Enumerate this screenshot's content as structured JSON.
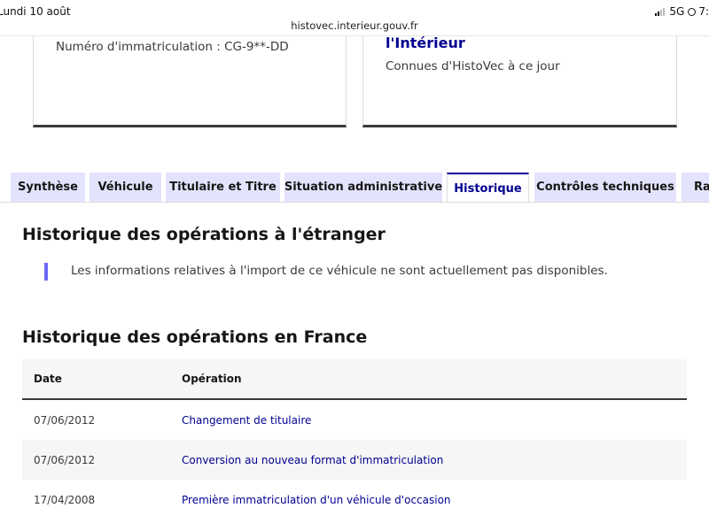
{
  "status_bar": {
    "date": "Lundi 10 août",
    "network": "5G",
    "time_partial": "7:",
    "url": "histovec.interieur.gouv.fr"
  },
  "cards": {
    "left": {
      "text": "Numéro d'immatriculation : CG-9**-DD"
    },
    "right": {
      "title": "l'Intérieur",
      "subtitle": "Connues d'HistoVec à ce jour"
    }
  },
  "tabs": [
    {
      "label": "Synthèse",
      "active": false
    },
    {
      "label": "Véhicule",
      "active": false
    },
    {
      "label": "Titulaire et Titre",
      "active": false
    },
    {
      "label": "Situation administrative",
      "active": false
    },
    {
      "label": "Historique",
      "active": true
    },
    {
      "label": "Contrôles techniques",
      "active": false
    },
    {
      "label": "Ra",
      "active": false
    }
  ],
  "foreign_section": {
    "title": "Historique des opérations à l'étranger",
    "notice": "Les informations relatives à l'import de ce véhicule ne sont actuellement pas disponibles."
  },
  "france_section": {
    "title": "Historique des opérations en France",
    "columns": [
      "Date",
      "Opération"
    ],
    "rows": [
      {
        "date": "07/06/2012",
        "operation": "Changement de titulaire"
      },
      {
        "date": "07/06/2012",
        "operation": "Conversion au nouveau format d'immatriculation"
      },
      {
        "date": "17/04/2008",
        "operation": "Première immatriculation d'un véhicule d'occasion"
      }
    ]
  },
  "colors": {
    "accent": "#000091",
    "tab_background": "#e3e3fd",
    "quote_bar": "#6a6af4"
  }
}
